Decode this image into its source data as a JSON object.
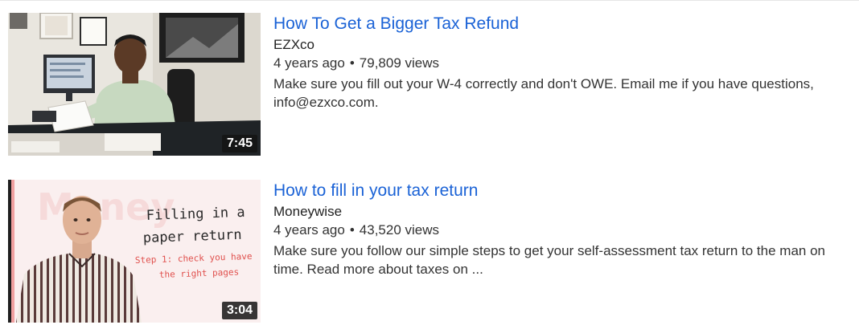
{
  "results": [
    {
      "title": "How To Get a Bigger Tax Refund",
      "channel": "EZXco",
      "age": "4 years ago",
      "separator": "•",
      "views": "79,809 views",
      "description": "Make sure you fill out your W-4 correctly and don't OWE. Email me if you have questions, info@ezxco.com.",
      "duration": "7:45",
      "thumbnail": "man-at-desk-office"
    },
    {
      "title": "How to fill in your tax return",
      "channel": "Moneywise",
      "age": "4 years ago",
      "separator": "•",
      "views": "43,520 views",
      "description": "Make sure you follow our simple steps to get your self-assessment tax return to the man on time. Read more about taxes on ...",
      "duration": "3:04",
      "thumbnail": "presenter-with-handwritten-text",
      "thumbnail_text": {
        "line1": "Filling in a",
        "line2": "paper return",
        "line3": "Step 1: check you have",
        "line4": "the right pages"
      }
    }
  ],
  "colors": {
    "title_link": "#1a62d6",
    "text": "#333333",
    "duration_bg": "#141414"
  }
}
